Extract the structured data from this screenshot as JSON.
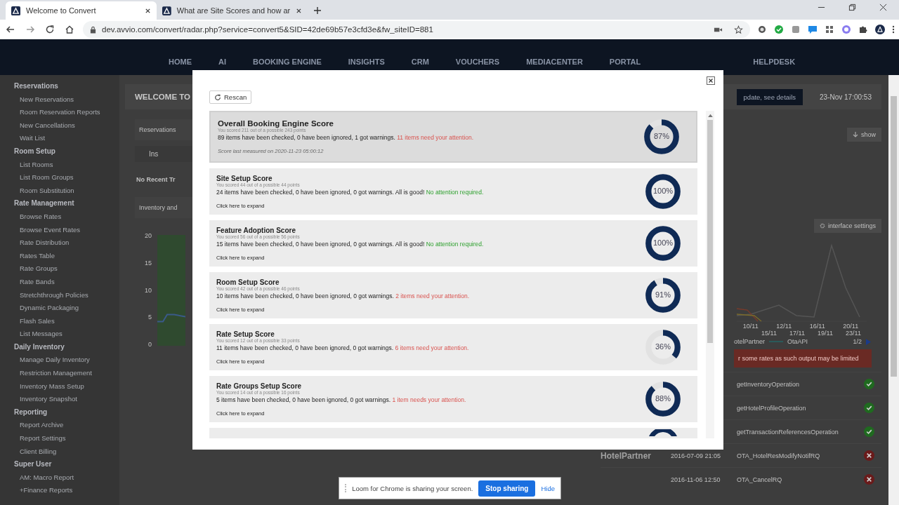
{
  "browser": {
    "tabs": [
      {
        "title": "Welcome to Convert",
        "selected": true
      },
      {
        "title": "What are Site Scores and how ar",
        "selected": false
      }
    ],
    "url": "dev.avvio.com/convert/radar.php?service=convert5&SID=42de69b57e3cfd3e&fw_siteID=881"
  },
  "nav": {
    "items": [
      "HOME",
      "AI",
      "BOOKING ENGINE",
      "INSIGHTS",
      "CRM",
      "VOUCHERS",
      "MEDIACENTER",
      "PORTAL"
    ],
    "helpdesk": "HELPDESK"
  },
  "sidebar": [
    {
      "title": "Reservations",
      "items": [
        "New Reservations",
        "Room Reservation Reports",
        "New Cancellations",
        "Wait List"
      ]
    },
    {
      "title": "Room Setup",
      "items": [
        "List Rooms",
        "List Room Groups",
        "Room Substitution"
      ]
    },
    {
      "title": "Rate Management",
      "items": [
        "Browse Rates",
        "Browse Event Rates",
        "Rate Distribution",
        "Rates Table",
        "Rate Groups",
        "Rate Bands",
        "Stretchthrough Policies",
        "Dynamic Packaging",
        "Flash Sales",
        "List Messages"
      ]
    },
    {
      "title": "Daily Inventory",
      "items": [
        "Manage Daily Inventory",
        "Restriction Management",
        "Inventory Mass Setup",
        "Inventory Snapshot"
      ]
    },
    {
      "title": "Reporting",
      "items": [
        "Report Archive",
        "Report Settings",
        "Client Billing"
      ]
    },
    {
      "title": "Super User",
      "items": [
        "AM: Macro Report",
        "+Finance Reports"
      ]
    }
  ],
  "main": {
    "heading": "WELCOME TO",
    "reservations_tab": "Reservations",
    "tab_short": "Ins",
    "no_recent": "No Recent Tr",
    "inventory_tab": "Inventory and",
    "y_ticks": [
      "20",
      "15",
      "10",
      "5",
      "0"
    ],
    "date": "23-Nov 17:00:53",
    "details_button": "pdate,  see details",
    "show_button": "show",
    "settings_button": "interface settings",
    "chart_x_top": [
      "10/11",
      "12/11",
      "16/11",
      "20/11"
    ],
    "chart_x_bottom": [
      "15/11",
      "17/11",
      "19/11",
      "23/11"
    ],
    "legend": [
      "otelPartner",
      "OtaAPI"
    ],
    "pager": "1/2",
    "banner": "r some rates as such output may be limited",
    "operations": [
      {
        "name": "getInventoryOperation",
        "success": true
      },
      {
        "name": "getHotelProfileOperation",
        "success": true
      },
      {
        "name": "getTransactionReferencesOperation",
        "success": true
      },
      {
        "name": "OTA_HotelResModifyNotifRQ",
        "time": "2016-07-09 21:05",
        "success": false
      },
      {
        "name": "OTA_CancelRQ",
        "time": "2016-11-06 12:50",
        "success": false
      }
    ],
    "partner_logo": "HotelPartner"
  },
  "modal": {
    "rescan": "Rescan",
    "cards": [
      {
        "kind": "overall",
        "title": "Overall Booking Engine Score",
        "points": "You scored 211 out of a possible 243 points",
        "summary": "89 items have been checked, 0 have been ignored, 1 got warnings.",
        "attention": true,
        "status_text": "11 items need your attention.",
        "footer": "Score last measured on 2020-11-23 05:00:12",
        "percent": "87%",
        "level": 0.87
      },
      {
        "kind": "section",
        "title": "Site Setup Score",
        "points": "You scored 44 out of a possible 44 points",
        "summary": "24 items have been checked, 0 have been ignored, 0 got warnings. All is good!",
        "attention": false,
        "status_text": "No attention required.",
        "footer": "Click here to expand",
        "percent": "100%",
        "level": 1
      },
      {
        "kind": "section",
        "title": "Feature Adoption Score",
        "points": "You scored 56 out of a possible 56 points",
        "summary": "15 items have been checked, 0 have been ignored, 0 got warnings. All is good!",
        "attention": false,
        "status_text": "No attention required.",
        "footer": "Click here to expand",
        "percent": "100%",
        "level": 1
      },
      {
        "kind": "section",
        "title": "Room Setup Score",
        "points": "You scored 42 out of a possible 46 points",
        "summary": "10 items have been checked, 0 have been ignored, 0 got warnings.",
        "attention": true,
        "status_text": "2 items need your attention.",
        "footer": "Click here to expand",
        "percent": "91%",
        "level": 0.91
      },
      {
        "kind": "section",
        "title": "Rate Setup Score",
        "points": "You scored 12 out of a possible 33 points",
        "summary": "11 items have been checked, 0 have been ignored, 0 got warnings.",
        "attention": true,
        "status_text": "6 items need your attention.",
        "footer": "Click here to expand",
        "percent": "36%",
        "level": 0.36
      },
      {
        "kind": "section",
        "title": "Rate Groups Setup Score",
        "points": "You scored 14 out of a possible 16 points",
        "summary": "5 items have been checked, 0 have been ignored, 0 got warnings.",
        "attention": true,
        "status_text": "1 item needs your attention.",
        "footer": "Click here to expand",
        "percent": "88%",
        "level": 0.88
      }
    ]
  },
  "loom": {
    "message": "Loom for Chrome is sharing your screen.",
    "stop": "Stop sharing",
    "hide": "Hide"
  }
}
